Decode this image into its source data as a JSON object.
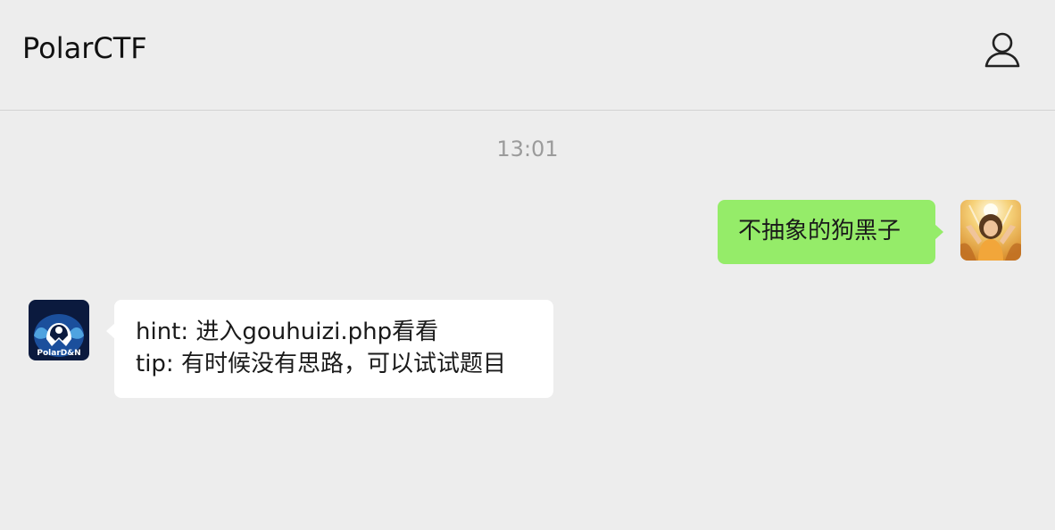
{
  "header": {
    "title": "PolarCTF",
    "profile_icon": "user-icon"
  },
  "chat": {
    "timestamp": "13:01",
    "messages": [
      {
        "sender": "me",
        "avatar_icon": "user-avatar",
        "lines": [
          "不抽象的狗黑子"
        ]
      },
      {
        "sender": "bot",
        "avatar_icon": "polard-n-logo",
        "avatar_text": "PolarD&N",
        "lines": [
          "hint: 进入gouhuizi.php看看",
          "tip: 有时候没有思路，可以试试题目"
        ]
      }
    ]
  },
  "colors": {
    "background": "#ededed",
    "my_bubble": "#95ec69",
    "other_bubble": "#ffffff",
    "timestamp": "#9b9b9b"
  }
}
